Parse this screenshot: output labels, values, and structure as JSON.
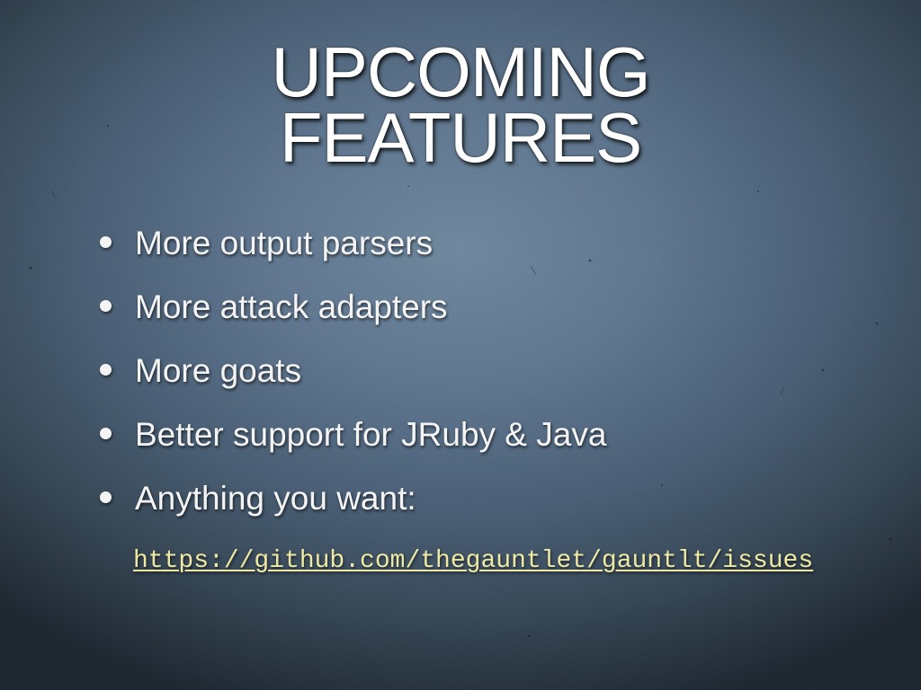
{
  "slide": {
    "title_line1": "UPCOMING",
    "title_line2": "FEATURES",
    "bullets": [
      "More output parsers",
      "More attack adapters",
      "More goats",
      "Better support for JRuby & Java",
      "Anything you want:"
    ],
    "link": "https://github.com/thegauntlet/gauntlt/issues"
  },
  "colors": {
    "title": "#ffffff",
    "text": "#f4f4f4",
    "link": "#eeeaa6",
    "bg_center": "#6a8299",
    "bg_edge": "#1d252e"
  },
  "icons": {
    "bullet": "bullet-dot-icon"
  }
}
